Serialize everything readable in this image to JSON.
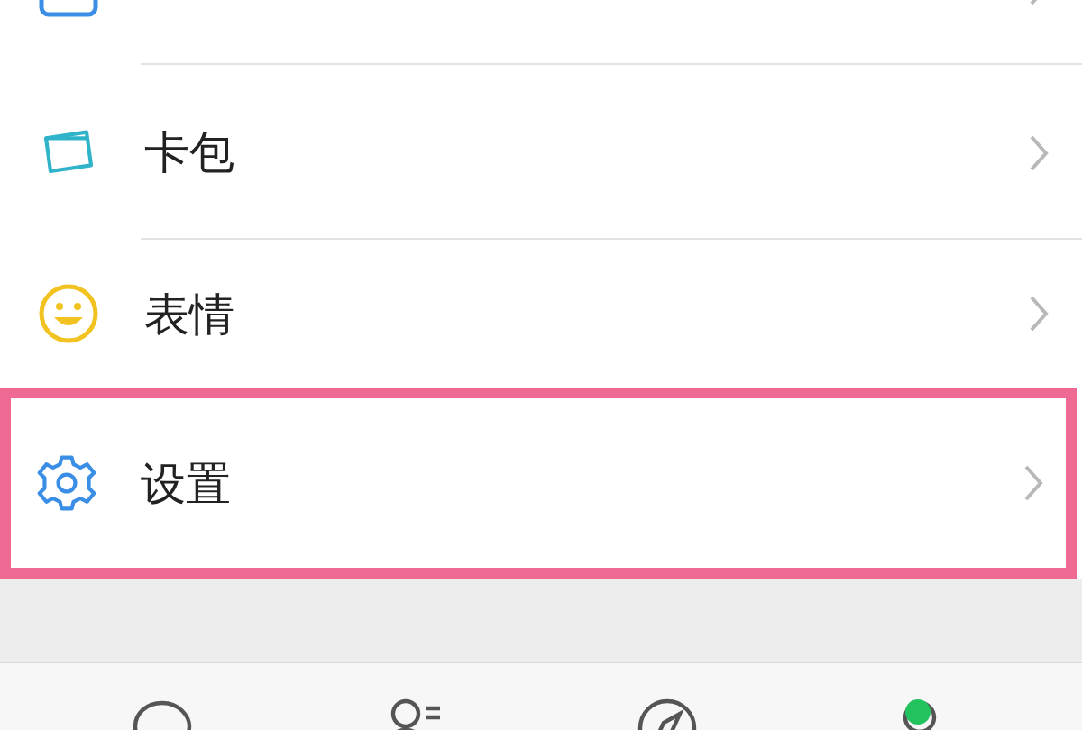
{
  "menu_rows": [
    {
      "kind": "moments",
      "highlighted": false
    },
    {
      "kind": "cards",
      "label": "卡包",
      "highlighted": false
    },
    {
      "kind": "stickers",
      "label": "表情",
      "highlighted": false
    },
    {
      "kind": "settings",
      "label": "设置",
      "highlighted": true
    }
  ],
  "tab_bar": [
    {
      "kind": "chats",
      "dot": false
    },
    {
      "kind": "contacts",
      "dot": false
    },
    {
      "kind": "discover",
      "dot": false
    },
    {
      "kind": "me",
      "dot": true
    }
  ]
}
